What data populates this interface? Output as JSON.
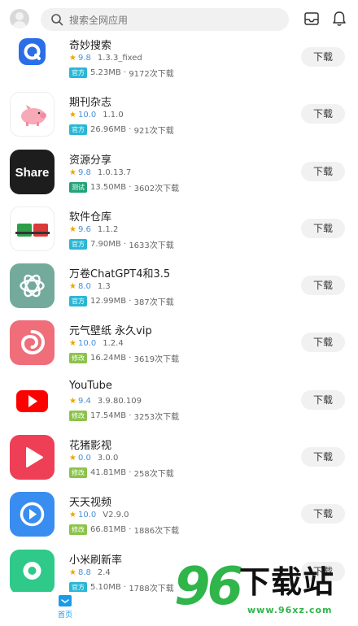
{
  "search": {
    "placeholder": "搜索全网应用"
  },
  "bottom_nav": {
    "home_label": "首页"
  },
  "watermark": {
    "number": "96",
    "title": "下载站",
    "url": "www.96xz.com"
  },
  "colors": {
    "official_tag": "#29b7d6",
    "test_tag": "#21a37a",
    "mod_tag": "#8bc34a",
    "home_active": "#1a9be8"
  },
  "apps": [
    {
      "name": "奇妙搜索",
      "rating": "9.8",
      "version": "1.3.3_fixed",
      "tag": "官方",
      "size": "5.23MB",
      "downloads": "9172次下载",
      "button": "下载"
    },
    {
      "name": "期刊杂志",
      "rating": "10.0",
      "version": "1.1.0",
      "tag": "官方",
      "size": "26.96MB",
      "downloads": "921次下载",
      "button": "下载"
    },
    {
      "name": "资源分享",
      "rating": "9.8",
      "version": "1.0.13.7",
      "tag": "测试",
      "size": "13.50MB",
      "downloads": "3602次下载",
      "button": "下载"
    },
    {
      "name": "软件仓库",
      "rating": "9.6",
      "version": "1.1.2",
      "tag": "官方",
      "size": "7.90MB",
      "downloads": "1633次下载",
      "button": "下载"
    },
    {
      "name": "万卷ChatGPT4和3.5",
      "rating": "8.0",
      "version": "1.3",
      "tag": "官方",
      "size": "12.99MB",
      "downloads": "387次下载",
      "button": "下载"
    },
    {
      "name": "元气壁纸 永久vip",
      "rating": "10.0",
      "version": "1.2.4",
      "tag": "修改",
      "size": "16.24MB",
      "downloads": "3619次下载",
      "button": "下载"
    },
    {
      "name": "YouTube",
      "rating": "9.4",
      "version": "3.9.80.109",
      "tag": "修改",
      "size": "17.54MB",
      "downloads": "3253次下载",
      "button": "下载"
    },
    {
      "name": "花猪影视",
      "rating": "0.0",
      "version": "3.0.0",
      "tag": "修改",
      "size": "41.81MB",
      "downloads": "258次下载",
      "button": "下载"
    },
    {
      "name": "天天视频",
      "rating": "10.0",
      "version": "V2.9.0",
      "tag": "修改",
      "size": "66.81MB",
      "downloads": "1886次下载",
      "button": "下载"
    },
    {
      "name": "小米刷新率",
      "rating": "8.8",
      "version": "2.4",
      "tag": "官方",
      "size": "5.10MB",
      "downloads": "1788次下载",
      "button": "下载"
    }
  ]
}
